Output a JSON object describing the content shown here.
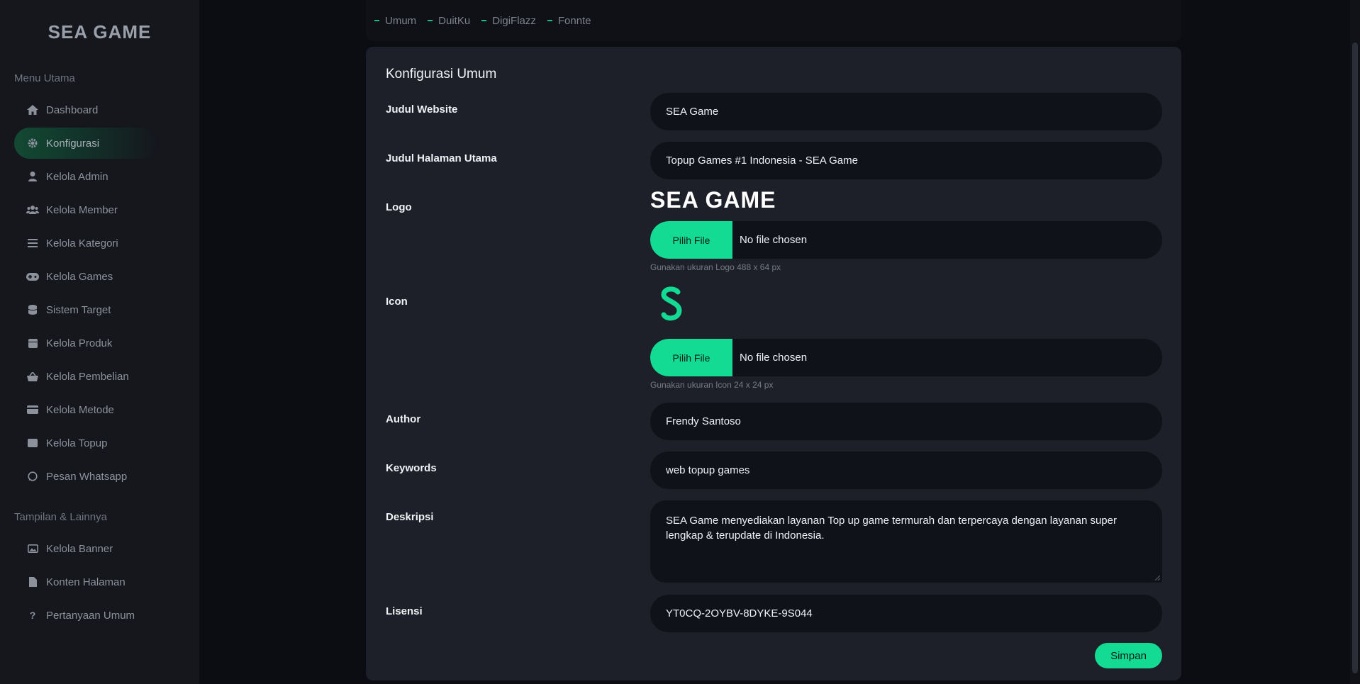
{
  "brand": {
    "name": "SEA GAME"
  },
  "sidebar": {
    "section_main": "Menu Utama",
    "section_other": "Tampilan & Lainnya",
    "items": [
      {
        "label": "Dashboard",
        "icon": "home-icon"
      },
      {
        "label": "Konfigurasi",
        "icon": "gear-icon"
      },
      {
        "label": "Kelola Admin",
        "icon": "user-icon"
      },
      {
        "label": "Kelola Member",
        "icon": "users-icon"
      },
      {
        "label": "Kelola Kategori",
        "icon": "list-icon"
      },
      {
        "label": "Kelola Games",
        "icon": "gamepad-icon"
      },
      {
        "label": "Sistem Target",
        "icon": "database-icon"
      },
      {
        "label": "Kelola Produk",
        "icon": "box-icon"
      },
      {
        "label": "Kelola Pembelian",
        "icon": "basket-icon"
      },
      {
        "label": "Kelola Metode",
        "icon": "card-icon"
      },
      {
        "label": "Kelola Topup",
        "icon": "wallet-icon"
      },
      {
        "label": "Pesan Whatsapp",
        "icon": "whatsapp-icon"
      }
    ],
    "other_items": [
      {
        "label": "Kelola Banner",
        "icon": "image-icon"
      },
      {
        "label": "Konten Halaman",
        "icon": "file-icon"
      },
      {
        "label": "Pertanyaan Umum",
        "icon": "question-icon"
      }
    ]
  },
  "tabs": [
    "Umum",
    "DuitKu",
    "DigiFlazz",
    "Fonnte"
  ],
  "form": {
    "title": "Konfigurasi Umum",
    "judul_website": {
      "label": "Judul Website",
      "value": "SEA Game"
    },
    "judul_halaman": {
      "label": "Judul Halaman Utama",
      "value": "Topup Games #1 Indonesia - SEA Game"
    },
    "logo": {
      "label": "Logo",
      "preview_text": "SEA GAME",
      "button": "Pilih File",
      "file_status": "No file chosen",
      "hint": "Gunakan ukuran Logo 488 x 64 px"
    },
    "icon": {
      "label": "Icon",
      "button": "Pilih File",
      "file_status": "No file chosen",
      "hint": "Gunakan ukuran Icon 24 x 24 px"
    },
    "author": {
      "label": "Author",
      "value": "Frendy Santoso"
    },
    "keywords": {
      "label": "Keywords",
      "value": "web topup games"
    },
    "deskripsi": {
      "label": "Deskripsi",
      "value": "SEA Game menyediakan layanan Top up game  termurah dan terpercaya  dengan layanan super lengkap & terupdate di Indonesia."
    },
    "lisensi": {
      "label": "Lisensi",
      "value": "YT0CQ-2OYBV-8DYKE-9S044"
    },
    "save_label": "Simpan"
  },
  "colors": {
    "accent": "#13db94",
    "sidebar_bg": "#15171d",
    "card_bg": "#1e2029",
    "field_bg": "#10121a"
  }
}
